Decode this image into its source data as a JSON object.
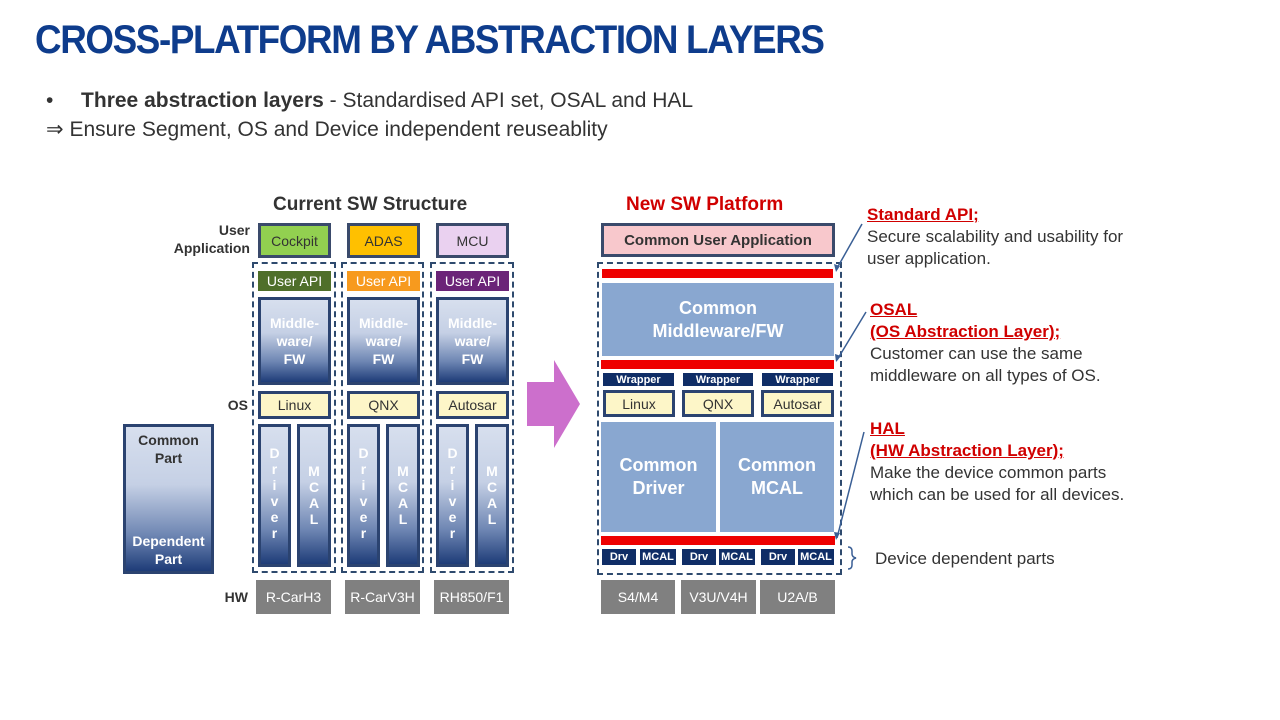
{
  "title": "CROSS-PLATFORM BY ABSTRACTION LAYERS",
  "bullets": {
    "bullet1_symbol": "•",
    "bullet1_bold": "Three abstraction layers",
    "bullet1_rest": " - Standardised API set, OSAL and HAL",
    "bullet2_symbol": "⇒",
    "bullet2_text": "Ensure Segment, OS and Device independent reuseablity"
  },
  "current": {
    "heading": "Current SW Structure",
    "row_labels": {
      "user_app_1": "User",
      "user_app_2": "Application",
      "os": "OS",
      "hw": "HW"
    },
    "legend": {
      "common": "Common",
      "common2": "Part",
      "dependent": "Dependent",
      "dependent2": "Part"
    },
    "columns": [
      {
        "app": "Cockpit",
        "app_color": "#92d050",
        "api": "User API",
        "api_color": "#4f6f2a",
        "mw1": "Middle-",
        "mw2": "ware/",
        "mw3": "FW",
        "os": "Linux",
        "driver": [
          "D",
          "r",
          "i",
          "v",
          "e",
          "r"
        ],
        "mcal": [
          "M",
          "C",
          "A",
          "L"
        ],
        "hw": "R-CarH3"
      },
      {
        "app": "ADAS",
        "app_color": "#ffc000",
        "api": "User API",
        "api_color": "#f79a1e",
        "mw1": "Middle-",
        "mw2": "ware/",
        "mw3": "FW",
        "os": "QNX",
        "driver": [
          "D",
          "r",
          "i",
          "v",
          "e",
          "r"
        ],
        "mcal": [
          "M",
          "C",
          "A",
          "L"
        ],
        "hw": "R-CarV3H"
      },
      {
        "app": "MCU",
        "app_color": "#ead1f0",
        "api": "User API",
        "api_color": "#6b2478",
        "mw1": "Middle-",
        "mw2": "ware/",
        "mw3": "FW",
        "os": "Autosar",
        "driver": [
          "D",
          "r",
          "i",
          "v",
          "e",
          "r"
        ],
        "mcal": [
          "M",
          "C",
          "A",
          "L"
        ],
        "hw": "RH850/F1"
      }
    ]
  },
  "new_platform": {
    "heading": "New SW Platform",
    "common_app": "Common User Application",
    "middleware1": "Common",
    "middleware2": "Middleware/FW",
    "wrappers": [
      "Wrapper",
      "Wrapper",
      "Wrapper"
    ],
    "os": [
      "Linux",
      "QNX",
      "Autosar"
    ],
    "driver1": "Common",
    "driver2": "Driver",
    "mcal1": "Common",
    "mcal2": "MCAL",
    "device_parts": [
      "Drv",
      "MCAL",
      "Drv",
      "MCAL",
      "Drv",
      "MCAL"
    ],
    "hw": [
      "S4/M4",
      "V3U/V4H",
      "U2A/B"
    ]
  },
  "callouts": {
    "api_head": "Standard API;",
    "api_text1": "Secure scalability and usability for",
    "api_text2": "user application.",
    "osal_head1": "OSAL",
    "osal_head2": "(OS Abstraction Layer);",
    "osal_text1": "Customer can use the same",
    "osal_text2": "middleware on all types of OS.",
    "hal_head1": "HAL",
    "hal_head2": "(HW Abstraction Layer);",
    "hal_text1": "Make the device common parts",
    "hal_text2": "which can be used for all devices.",
    "device_dependent": "Device dependent parts"
  },
  "colors": {
    "title": "#0e3c8c",
    "accent_red": "#d00000",
    "arrow": "#cc6fcc",
    "common_app_bg": "#f8c8cc"
  }
}
